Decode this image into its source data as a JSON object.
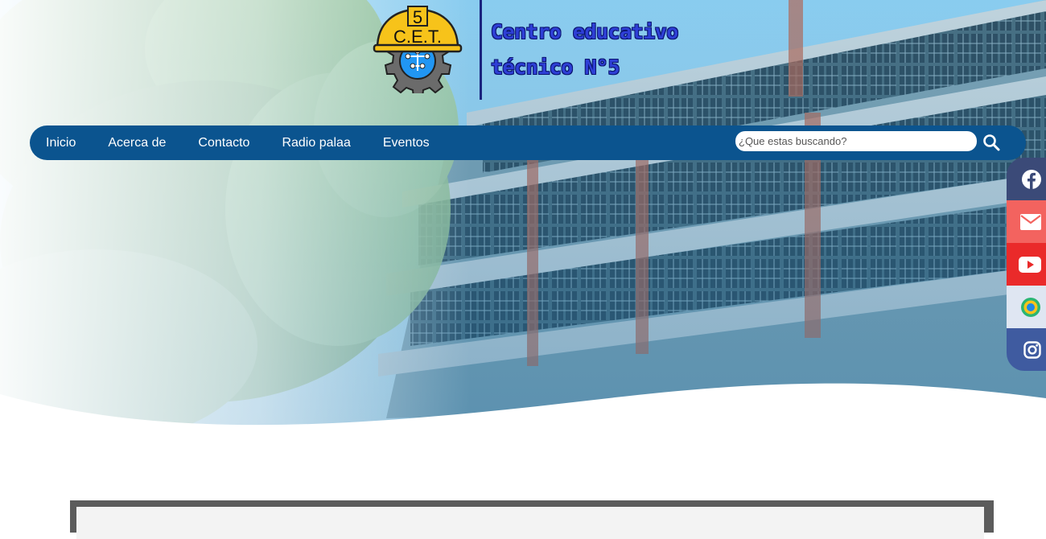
{
  "brand": {
    "logo_number": "5",
    "logo_text": "C.E.T.",
    "title": "Centro educativo\ntécnico N°5"
  },
  "nav": {
    "items": [
      {
        "label": "Inicio"
      },
      {
        "label": "Acerca de"
      },
      {
        "label": "Contacto"
      },
      {
        "label": "Radio palaa"
      },
      {
        "label": "Eventos"
      }
    ]
  },
  "search": {
    "placeholder": "¿Que estas buscando?",
    "icon": "search-icon"
  },
  "social": [
    {
      "icon": "facebook-icon",
      "color": "#3b4a78"
    },
    {
      "icon": "mail-icon",
      "color": "#f3635f"
    },
    {
      "icon": "youtube-icon",
      "color": "#ea2a2a"
    },
    {
      "icon": "radio-logo-icon",
      "color": "#dfe6f2"
    },
    {
      "icon": "instagram-icon",
      "color": "#3f5ba0"
    }
  ],
  "colors": {
    "navbar": "#0b548f",
    "brand_text": "#2e3fd6",
    "divider": "#1a237e"
  }
}
